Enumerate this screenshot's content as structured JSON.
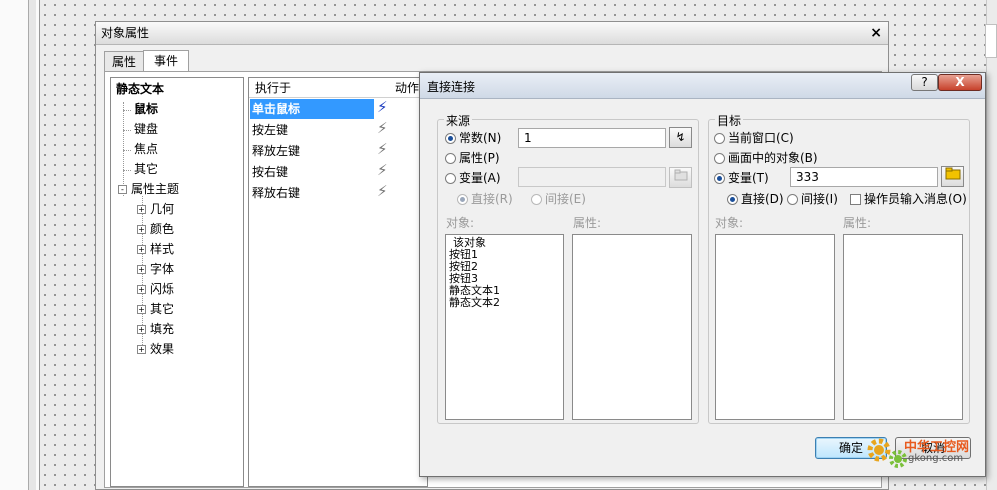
{
  "props_window": {
    "title": "对象属性",
    "close_glyph": "×",
    "tabs": [
      {
        "label": "属性",
        "active": false
      },
      {
        "label": "事件",
        "active": true
      }
    ],
    "tree": {
      "root": "静态文本",
      "children": [
        "鼠标",
        "键盘",
        "焦点",
        "其它"
      ],
      "theme": {
        "label": "属性主题",
        "expand_glyph": "-",
        "items": [
          "几何",
          "颜色",
          "样式",
          "字体",
          "闪烁",
          "其它",
          "填充",
          "效果"
        ],
        "item_glyph": "+"
      }
    },
    "events": {
      "col_exec": "执行于",
      "col_action": "动作",
      "rows": [
        "单击鼠标",
        "按左键",
        "释放左键",
        "按右键",
        "释放右键"
      ],
      "selected_index": 0,
      "bolt_glyph": "⚡"
    }
  },
  "dialog": {
    "title": "直接连接",
    "help_label": "?",
    "close_label": "X",
    "source": {
      "label": "来源",
      "constant_label": "常数(N)",
      "constant_value": "1",
      "property_label": "属性(P)",
      "variable_label": "变量(A)",
      "variable_value": "",
      "direct_label": "直接(R)",
      "indirect_label": "间接(E)",
      "object_label": "对象:",
      "property_list_label": "属性:",
      "objects": [
        "该对象",
        "按钮1",
        "按钮2",
        "按钮3",
        "静态文本1",
        "静态文本2"
      ],
      "pick_glyph": "↯"
    },
    "target": {
      "label": "目标",
      "current_window_label": "当前窗口(C)",
      "screen_object_label": "画面中的对象(B)",
      "variable_label": "变量(T)",
      "variable_value": "333",
      "direct_label": "直接(D)",
      "indirect_label": "间接(I)",
      "operator_msg_label": "操作员输入消息(O)",
      "object_label": "对象:",
      "property_list_label": "属性:"
    },
    "ok_label": "确定",
    "cancel_label": "取消"
  },
  "watermark": {
    "brand": "中华工控网",
    "url": "gkong.com"
  },
  "colors": {
    "selection": "#3399ff",
    "title_gradient_top": "#e9eef6",
    "close_button": "#c7412b",
    "folder_icon": "#f2c200"
  }
}
